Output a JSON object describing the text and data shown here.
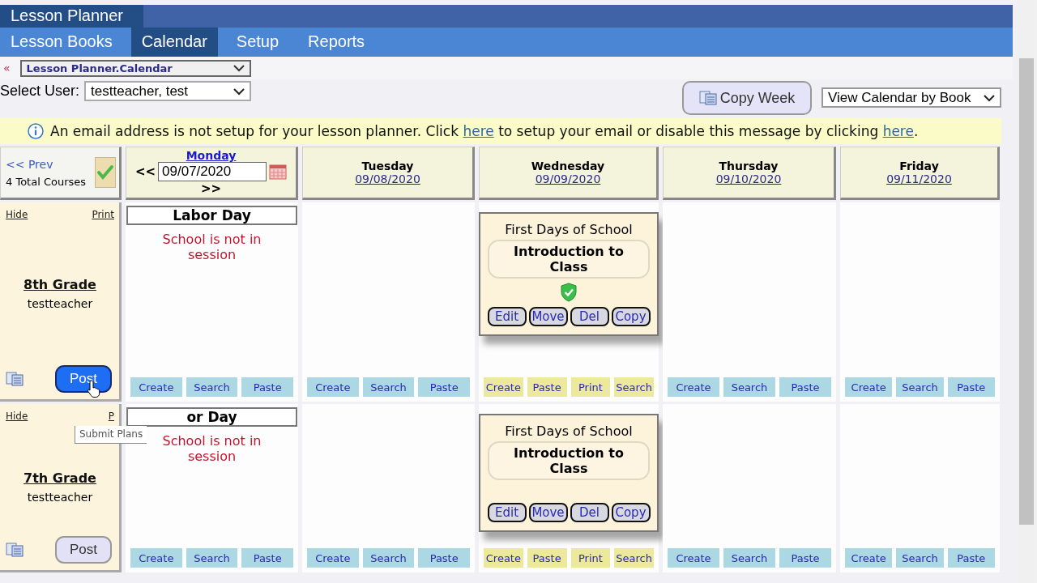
{
  "app_title": "Lesson Planner",
  "nav_tabs": [
    {
      "label": "Lesson Books",
      "selected": false
    },
    {
      "label": "Calendar",
      "selected": true
    },
    {
      "label": "Setup",
      "selected": false
    },
    {
      "label": "Reports",
      "selected": false
    }
  ],
  "breadcrumb": {
    "back": "«",
    "page": "Lesson Planner.Calendar"
  },
  "user_select": {
    "label": "Select User:",
    "value": "testteacher, test"
  },
  "copy_week": "Copy Week",
  "view_select": "View Calendar by Book",
  "notice": [
    {
      "kind": "text",
      "text": "An email address is not setup for your lesson planner. Click "
    },
    {
      "kind": "link",
      "text": "here"
    },
    {
      "kind": "text",
      "text": " to setup your email or disable this message by clicking "
    },
    {
      "kind": "link",
      "text": "here"
    },
    {
      "kind": "text",
      "text": "."
    }
  ],
  "week_nav": {
    "prev": "<< Prev",
    "total": "4 Total Courses"
  },
  "days": [
    {
      "kind": "picker",
      "name": "Monday",
      "date": "09/07/2020",
      "prev": "<<",
      "next": ">>"
    },
    {
      "kind": "plain",
      "name": "Tuesday",
      "date": "09/08/2020"
    },
    {
      "kind": "plain",
      "name": "Wednesday",
      "date": "09/09/2020"
    },
    {
      "kind": "plain",
      "name": "Thursday",
      "date": "09/10/2020"
    },
    {
      "kind": "plain",
      "name": "Friday",
      "date": "09/11/2020"
    }
  ],
  "courses": [
    {
      "hide": "Hide",
      "print": "Print",
      "name": "8th Grade",
      "teacher": "testteacher",
      "post": "Post",
      "highlighted": true,
      "days": [
        {
          "kind": "holiday",
          "title": "Labor Day",
          "note": "School is not in session",
          "actions": [
            "Create",
            "Search",
            "Paste"
          ]
        },
        {
          "kind": "empty",
          "actions": [
            "Create",
            "Search",
            "Paste"
          ]
        },
        {
          "kind": "lesson",
          "unit": "First Days of School",
          "title": "Introduction to Class",
          "approved": true,
          "buttons": [
            "Edit",
            "Move",
            "Del",
            "Copy"
          ],
          "actions": [
            "Create",
            "Paste",
            "Print",
            "Search"
          ]
        },
        {
          "kind": "empty",
          "actions": [
            "Create",
            "Search",
            "Paste"
          ]
        },
        {
          "kind": "empty",
          "actions": [
            "Create",
            "Search",
            "Paste"
          ]
        }
      ]
    },
    {
      "hide": "Hide",
      "print": "P",
      "name": "7th Grade",
      "teacher": "testteacher",
      "post": "Post",
      "highlighted": false,
      "days": [
        {
          "kind": "holiday",
          "title": "or Day",
          "note": "School is not in session",
          "actions": [
            "Create",
            "Search",
            "Paste"
          ]
        },
        {
          "kind": "empty",
          "actions": [
            "Create",
            "Search",
            "Paste"
          ]
        },
        {
          "kind": "lesson",
          "unit": "First Days of School",
          "title": "Introduction to Class",
          "approved": false,
          "buttons": [
            "Edit",
            "Move",
            "Del",
            "Copy"
          ],
          "actions": [
            "Create",
            "Paste",
            "Print",
            "Search"
          ]
        },
        {
          "kind": "empty",
          "actions": [
            "Create",
            "Search",
            "Paste"
          ]
        },
        {
          "kind": "empty",
          "actions": [
            "Create",
            "Search",
            "Paste"
          ]
        }
      ]
    }
  ],
  "tooltip": "Submit Plans"
}
